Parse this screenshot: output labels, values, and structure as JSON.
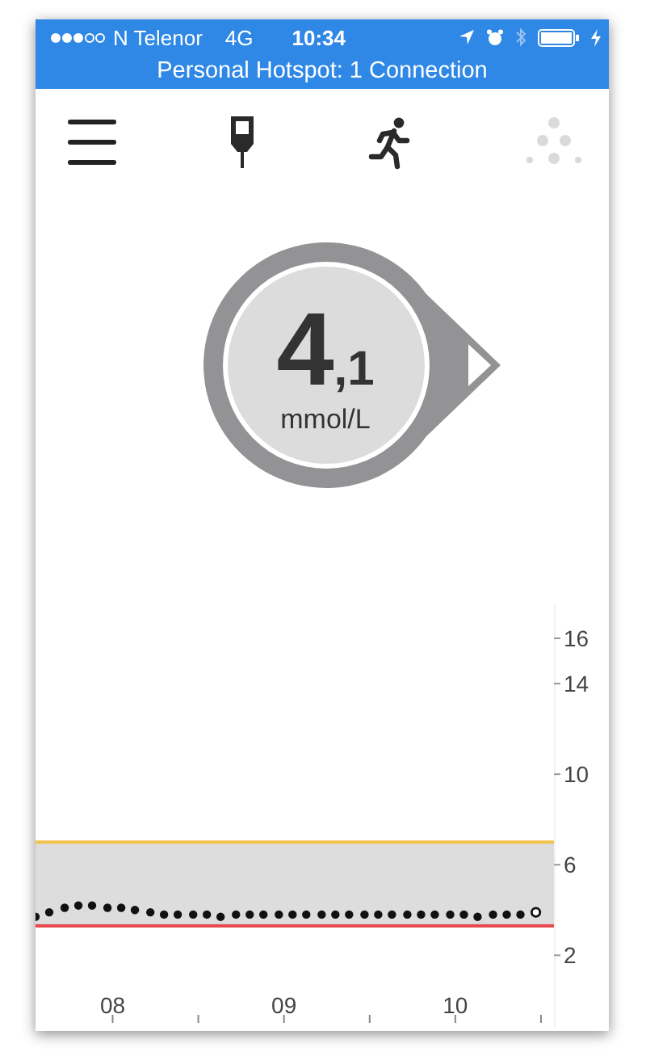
{
  "status_bar": {
    "carrier": "N Telenor",
    "network": "4G",
    "time": "10:34"
  },
  "hotspot_banner": {
    "text": "Personal Hotspot: 1 Connection"
  },
  "glucose": {
    "whole": "4",
    "decimal": ",1",
    "unit": "mmol/L"
  },
  "chart": {
    "chart_data": {
      "type": "scatter",
      "x": [
        7.55,
        7.63,
        7.72,
        7.8,
        7.88,
        7.97,
        8.05,
        8.13,
        8.22,
        8.3,
        8.38,
        8.47,
        8.55,
        8.63,
        8.72,
        8.8,
        8.88,
        8.97,
        9.05,
        9.13,
        9.22,
        9.3,
        9.38,
        9.47,
        9.55,
        9.63,
        9.72,
        9.8,
        9.88,
        9.97,
        10.05,
        10.13,
        10.22,
        10.3,
        10.38,
        10.47
      ],
      "series": [
        {
          "color": "#111111",
          "values": [
            3.7,
            3.9,
            4.1,
            4.2,
            4.2,
            4.1,
            4.1,
            4.0,
            3.9,
            3.8,
            3.8,
            3.8,
            3.8,
            3.7,
            3.8,
            3.8,
            3.8,
            3.8,
            3.8,
            3.8,
            3.8,
            3.8,
            3.8,
            3.8,
            3.8,
            3.8,
            3.8,
            3.8,
            3.8,
            3.8,
            3.8,
            3.7,
            3.8,
            3.8,
            3.8,
            3.9
          ]
        }
      ],
      "xlim": [
        7.55,
        10.585
      ],
      "ylim": [
        -1.2,
        17.5
      ],
      "xticks": [
        {
          "value": 8,
          "label": "08"
        },
        {
          "value": 9,
          "label": "09"
        },
        {
          "value": 10,
          "label": "10"
        }
      ],
      "yticks": [
        2,
        6,
        10,
        14,
        16
      ],
      "bands": [
        {
          "axis": "y",
          "from": 3.3,
          "to": 7.0,
          "color": "#dddddd"
        }
      ],
      "ref_lines": [
        {
          "axis": "y",
          "value": 7.0,
          "color": "#f2c14e"
        },
        {
          "axis": "y",
          "value": 3.3,
          "color": "#e8474f"
        }
      ]
    }
  }
}
